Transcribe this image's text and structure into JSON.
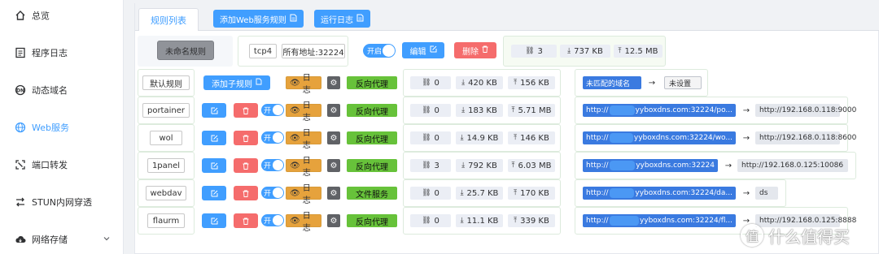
{
  "sidebar": {
    "items": [
      {
        "label": "总览",
        "icon": "home-icon"
      },
      {
        "label": "程序日志",
        "icon": "log-file-icon"
      },
      {
        "label": "动态域名",
        "icon": "ddns-icon"
      },
      {
        "label": "Web服务",
        "icon": "globe-icon"
      },
      {
        "label": "端口转发",
        "icon": "port-forward-icon"
      },
      {
        "label": "STUN内网穿透",
        "icon": "stun-icon"
      },
      {
        "label": "网络存储",
        "icon": "cloud-storage-icon"
      }
    ]
  },
  "tabs": {
    "active": "规则列表",
    "add_web_rule": "添加Web服务规则",
    "run_log": "运行日志"
  },
  "colors": {
    "primary": "#409eff",
    "danger": "#f56c6c",
    "warning": "#e6a23c",
    "success": "#67c23a"
  },
  "top_rule": {
    "name": "未命名规则",
    "protocol": "tcp4",
    "address": "所有地址:32224",
    "toggle": "开启",
    "edit": "编辑",
    "delete": "删除",
    "connections": "3",
    "download": "737 KB",
    "upload": "12.5 MB"
  },
  "default_rule": {
    "name": "默认规则",
    "add_sub": "添加子规则",
    "log": "日志",
    "service": "反向代理",
    "connections": "0",
    "download": "420 KB",
    "upload": "156 KB",
    "unmatched": "未匹配的域名",
    "unset": "未设置"
  },
  "sub_rules": [
    {
      "name": "portainer",
      "toggle": "开",
      "log": "日志",
      "service": "反向代理",
      "connections": "0",
      "download": "183 KB",
      "upload": "5.71 MB",
      "domain_prefix": "http://",
      "domain_suffix": "yyboxdns.com:32224/po...",
      "target": "http://192.168.0.118:9000"
    },
    {
      "name": "wol",
      "toggle": "开",
      "log": "日志",
      "service": "反向代理",
      "connections": "0",
      "download": "14.9 KB",
      "upload": "146 KB",
      "domain_prefix": "http://",
      "domain_suffix": "yyboxdns.com:32224/wo...",
      "target": "http://192.168.0.118:8600"
    },
    {
      "name": "1panel",
      "toggle": "开",
      "log": "日志",
      "service": "反向代理",
      "connections": "3",
      "download": "792 KB",
      "upload": "6.03 MB",
      "domain_prefix": "http://",
      "domain_suffix": "yyboxdns.com:32224",
      "target": "http://192.168.0.125:10086"
    },
    {
      "name": "webdav",
      "toggle": "开",
      "log": "日志",
      "service": "文件服务",
      "connections": "0",
      "download": "25.7 KB",
      "upload": "170 KB",
      "domain_prefix": "http://",
      "domain_suffix": "yyboxdns.com:32224/da...",
      "target": "ds"
    },
    {
      "name": "flaurm",
      "toggle": "开",
      "log": "日志",
      "service": "反向代理",
      "connections": "0",
      "download": "11.1 KB",
      "upload": "339 KB",
      "domain_prefix": "http://",
      "domain_suffix": "yyboxdns.com:32224/fl...",
      "target": "http://192.168.0.125:8888"
    }
  ],
  "watermark": {
    "logo": "值",
    "text": "什么值得买"
  }
}
